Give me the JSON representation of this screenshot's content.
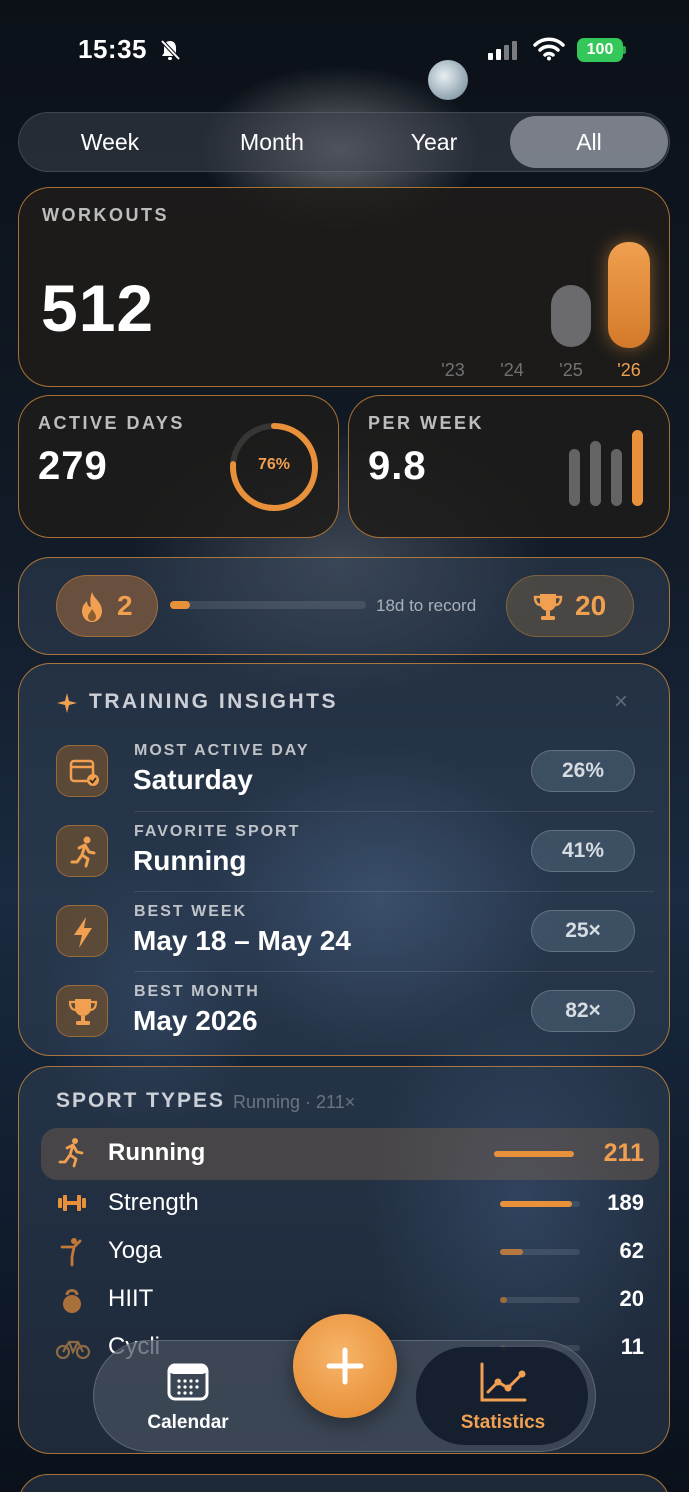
{
  "status_bar": {
    "time": "15:35",
    "battery": "100"
  },
  "filter": {
    "options": [
      "Week",
      "Month",
      "Year",
      "All"
    ],
    "selected": "All"
  },
  "workouts": {
    "label": "WORKOUTS",
    "value": "512",
    "years": [
      {
        "label": "'23",
        "relative": 0
      },
      {
        "label": "'24",
        "relative": 0
      },
      {
        "label": "'25",
        "relative": 0.6
      },
      {
        "label": "'26",
        "relative": 1.0
      }
    ]
  },
  "active_days": {
    "label": "ACTIVE DAYS",
    "value": "279",
    "percent_label": "76%",
    "percent": 76
  },
  "per_week": {
    "label": "PER WEEK",
    "value": "9.8",
    "bars": [
      0.75,
      0.85,
      0.75,
      1.0
    ]
  },
  "streak": {
    "current": "2",
    "progress_text": "18d to record",
    "progress": 0.1,
    "record": "20"
  },
  "insights": {
    "title": "TRAINING INSIGHTS",
    "items": [
      {
        "label": "MOST ACTIVE DAY",
        "value": "Saturday",
        "badge": "26%",
        "icon": "calendar-check-icon"
      },
      {
        "label": "FAVORITE SPORT",
        "value": "Running",
        "badge": "41%",
        "icon": "running-icon"
      },
      {
        "label": "BEST WEEK",
        "value": "May 18 – May 24",
        "badge": "25×",
        "icon": "bolt-icon"
      },
      {
        "label": "BEST MONTH",
        "value": "May 2026",
        "badge": "82×",
        "icon": "trophy-icon"
      }
    ]
  },
  "sport_types": {
    "title": "SPORT TYPES",
    "subtitle": "Running · 211×",
    "items": [
      {
        "name": "Running",
        "value": "211",
        "fraction": 1.0
      },
      {
        "name": "Strength",
        "value": "189",
        "fraction": 0.9
      },
      {
        "name": "Yoga",
        "value": "62",
        "fraction": 0.29
      },
      {
        "name": "HIIT",
        "value": "20",
        "fraction": 0.09
      },
      {
        "name": "Cycli",
        "value": "11",
        "fraction": 0.05
      }
    ]
  },
  "tabbar": {
    "calendar": "Calendar",
    "statistics": "Statistics",
    "active": "Statistics"
  },
  "colors": {
    "accent": "#e8913a",
    "card_border": "#d68c3c"
  }
}
